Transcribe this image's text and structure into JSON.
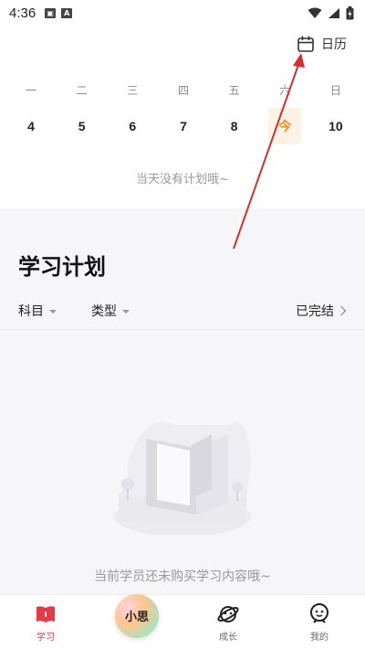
{
  "status_bar": {
    "time": "4:36"
  },
  "header": {
    "calendar_label": "日历"
  },
  "week": {
    "days": [
      "一",
      "二",
      "三",
      "四",
      "五",
      "六",
      "日"
    ],
    "dates": [
      "4",
      "5",
      "6",
      "7",
      "8",
      "今",
      "10"
    ],
    "today_index": 5
  },
  "empty_day_text": "当天没有计划哦~",
  "plan": {
    "title": "学习计划",
    "filter_subject": "科目",
    "filter_type": "类型",
    "completed_label": "已完结"
  },
  "empty_state_text": "当前学员还未购买学习内容哦~",
  "nav": {
    "study": "学习",
    "xiaosi": "小思",
    "growth": "成长",
    "mine": "我的"
  },
  "colors": {
    "accent": "#e63946",
    "today": "#f08a24",
    "annotation_arrow": "#d32f2f"
  }
}
